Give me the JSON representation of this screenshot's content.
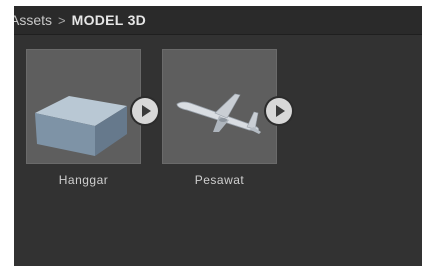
{
  "breadcrumb": {
    "root": "Assets",
    "separator": ">",
    "current": "MODEL 3D"
  },
  "assets": [
    {
      "label": "Hanggar",
      "icon": "cube-model-icon"
    },
    {
      "label": "Pesawat",
      "icon": "airplane-model-icon"
    }
  ],
  "colors": {
    "panel_bg": "#323232",
    "thumb_bg": "#5e5e5e",
    "play_button": "#d8d8d8"
  }
}
